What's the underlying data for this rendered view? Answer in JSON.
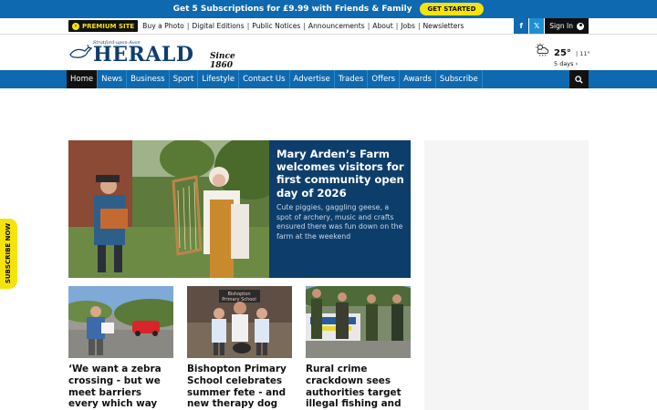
{
  "promo": {
    "text": "Get 5 Subscriptions for £9.99 with Friends & Family",
    "button": "GET STARTED"
  },
  "utility": {
    "premium_label": "PREMIUM SITE",
    "links": [
      "Buy a Photo",
      "Digital Editions",
      "Public Notices",
      "Announcements",
      "About",
      "Jobs",
      "Newsletters"
    ],
    "facebook_glyph": "f",
    "twitter_glyph": "𝕏",
    "sign_in": "Sign In"
  },
  "masthead": {
    "logo_small": "Stratford-upon-Avon",
    "logo_main": "HERALD",
    "logo_since": "Since 1860",
    "weather": {
      "temp": "25°",
      "low": "| 11°",
      "days": "5 days ›"
    }
  },
  "nav": {
    "items": [
      "Home",
      "News",
      "Business",
      "Sport",
      "Lifestyle",
      "Contact Us",
      "Advertise",
      "Trades",
      "Offers",
      "Awards",
      "Subscribe"
    ],
    "active": "Home"
  },
  "side_tab": "SUBSCRIBE NOW",
  "hero": {
    "title": "Mary Arden’s Farm welcomes visitors for first community open day of 2026",
    "description": "Cute piggies, gaggling geese, a spot of archery, music and crafts ensured there was fun down on the farm at the weekend"
  },
  "cards": [
    {
      "title": "‘We want a zebra crossing - but we meet barriers every which way we try to"
    },
    {
      "title": "Bishopton Primary School celebrates summer fete - and new therapy dog"
    },
    {
      "title": "Rural crime crackdown sees authorities target illegal fishing and"
    }
  ],
  "photo_texts": {
    "school_sign": "Bishopton Primary School"
  },
  "colors": {
    "brand_blue": "#0e69b0",
    "hero_navy": "#0d3e6b",
    "accent_yellow": "#f5e30b"
  }
}
